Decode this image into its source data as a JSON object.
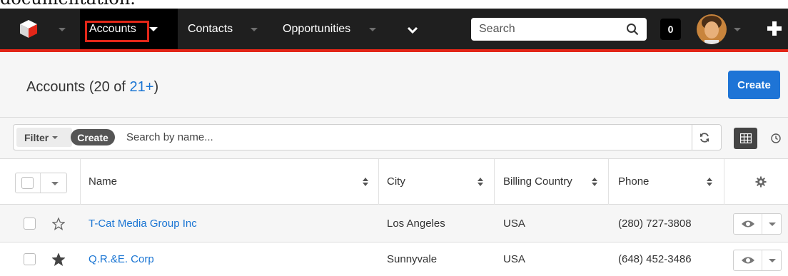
{
  "caption": "documentation.",
  "nav": {
    "items": [
      {
        "label": "Accounts",
        "active": true
      },
      {
        "label": "Contacts",
        "active": false
      },
      {
        "label": "Opportunities",
        "active": false
      }
    ],
    "search_placeholder": "Search",
    "notifications_count": "0",
    "colors": {
      "bar": "#1f1f1f",
      "accent_line": "#e22618",
      "highlight_box": "#e22618"
    }
  },
  "header": {
    "title_prefix": "Accounts (20 of ",
    "count_link": "21+",
    "title_suffix": ")",
    "create_label": "Create"
  },
  "filter": {
    "filter_label": "Filter",
    "create_label": "Create",
    "search_placeholder": "Search by name..."
  },
  "table": {
    "columns": [
      "Name",
      "City",
      "Billing Country",
      "Phone"
    ],
    "rows": [
      {
        "name": "T-Cat Media Group Inc",
        "city": "Los Angeles",
        "country": "USA",
        "phone": "(280) 727-3808",
        "favorite": false
      },
      {
        "name": "Q.R.&E. Corp",
        "city": "Sunnyvale",
        "country": "USA",
        "phone": "(648) 452-3486",
        "favorite": true
      }
    ]
  },
  "icons": [
    "cube-logo-icon",
    "chevron-down-icon",
    "search-icon",
    "avatar",
    "plus-icon",
    "refresh-icon",
    "grid-view-icon",
    "clock-icon",
    "sort-icon",
    "gear-icon",
    "star-icon",
    "eye-icon",
    "caret-down-icon"
  ]
}
